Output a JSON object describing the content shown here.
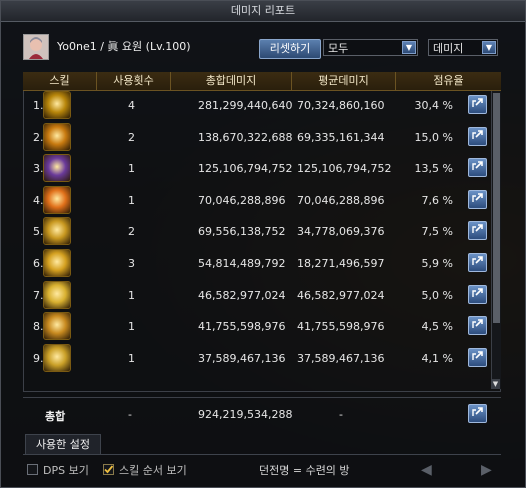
{
  "window": {
    "title": "데미지 리포트"
  },
  "character": {
    "name": "Yo0ne1  /  眞 요원 (Lv.100)"
  },
  "toolbar": {
    "reset_label": "리셋하기",
    "filter_select": "모두",
    "type_select": "데미지"
  },
  "table": {
    "headers": [
      "스킬",
      "사용횟수",
      "총합데미지",
      "평균데미지",
      "점유율"
    ],
    "rows": [
      {
        "num": "1.",
        "uses": "4",
        "total": "281,299,440,640",
        "avg": "70,324,860,160",
        "share": "30,4 %",
        "icon_color": "#b8860b"
      },
      {
        "num": "2.",
        "uses": "2",
        "total": "138,670,322,688",
        "avg": "69,335,161,344",
        "share": "15,0 %",
        "icon_color": "#c87a10"
      },
      {
        "num": "3.",
        "uses": "1",
        "total": "125,106,794,752",
        "avg": "125,106,794,752",
        "share": "13,5 %",
        "icon_color": "#6a3a9a"
      },
      {
        "num": "4.",
        "uses": "1",
        "total": "70,046,288,896",
        "avg": "70,046,288,896",
        "share": "7,6 %",
        "icon_color": "#e0701a"
      },
      {
        "num": "5.",
        "uses": "2",
        "total": "69,556,138,752",
        "avg": "34,778,069,376",
        "share": "7,5 %",
        "icon_color": "#c89820"
      },
      {
        "num": "6.",
        "uses": "3",
        "total": "54,814,489,792",
        "avg": "18,271,496,597",
        "share": "5,9 %",
        "icon_color": "#d4a020"
      },
      {
        "num": "7.",
        "uses": "1",
        "total": "46,582,977,024",
        "avg": "46,582,977,024",
        "share": "5,0 %",
        "icon_color": "#d8b030"
      },
      {
        "num": "8.",
        "uses": "1",
        "total": "41,755,598,976",
        "avg": "41,755,598,976",
        "share": "4,5 %",
        "icon_color": "#c88a20"
      },
      {
        "num": "9.",
        "uses": "1",
        "total": "37,589,467,136",
        "avg": "37,589,467,136",
        "share": "4,1 %",
        "icon_color": "#caa028"
      }
    ],
    "total": {
      "label": "총합",
      "uses": "-",
      "total": "924,219,534,288",
      "avg": "-"
    }
  },
  "tabs": {
    "used_settings": "사용한 설정"
  },
  "footer": {
    "dps_label": "DPS 보기",
    "skill_order_label": "스킬 순서 보기",
    "dungeon_text": "던전명 = 수련의 방"
  }
}
